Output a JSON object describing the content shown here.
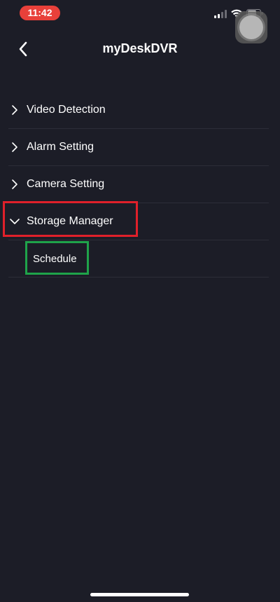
{
  "status_bar": {
    "time": "11:42",
    "time_pill_color": "#e8403a",
    "icons": [
      "signal-icon",
      "wifi-icon",
      "battery-icon"
    ]
  },
  "header": {
    "title": "myDeskDVR",
    "back_icon": "chevron-left-icon"
  },
  "menu": {
    "items": [
      {
        "label": "Video Detection",
        "icon": "chevron-right-icon",
        "expanded": false
      },
      {
        "label": "Alarm Setting",
        "icon": "chevron-right-icon",
        "expanded": false
      },
      {
        "label": "Camera Setting",
        "icon": "chevron-right-icon",
        "expanded": false
      },
      {
        "label": "Storage Manager",
        "icon": "chevron-down-icon",
        "expanded": true
      }
    ],
    "sub_items": [
      {
        "label": "Schedule"
      }
    ]
  },
  "annotations": {
    "red_box_color": "#e0202a",
    "green_box_color": "#1fa34a"
  },
  "colors": {
    "background": "#1c1d27",
    "divider": "#2c2d38",
    "text": "#ffffff"
  }
}
